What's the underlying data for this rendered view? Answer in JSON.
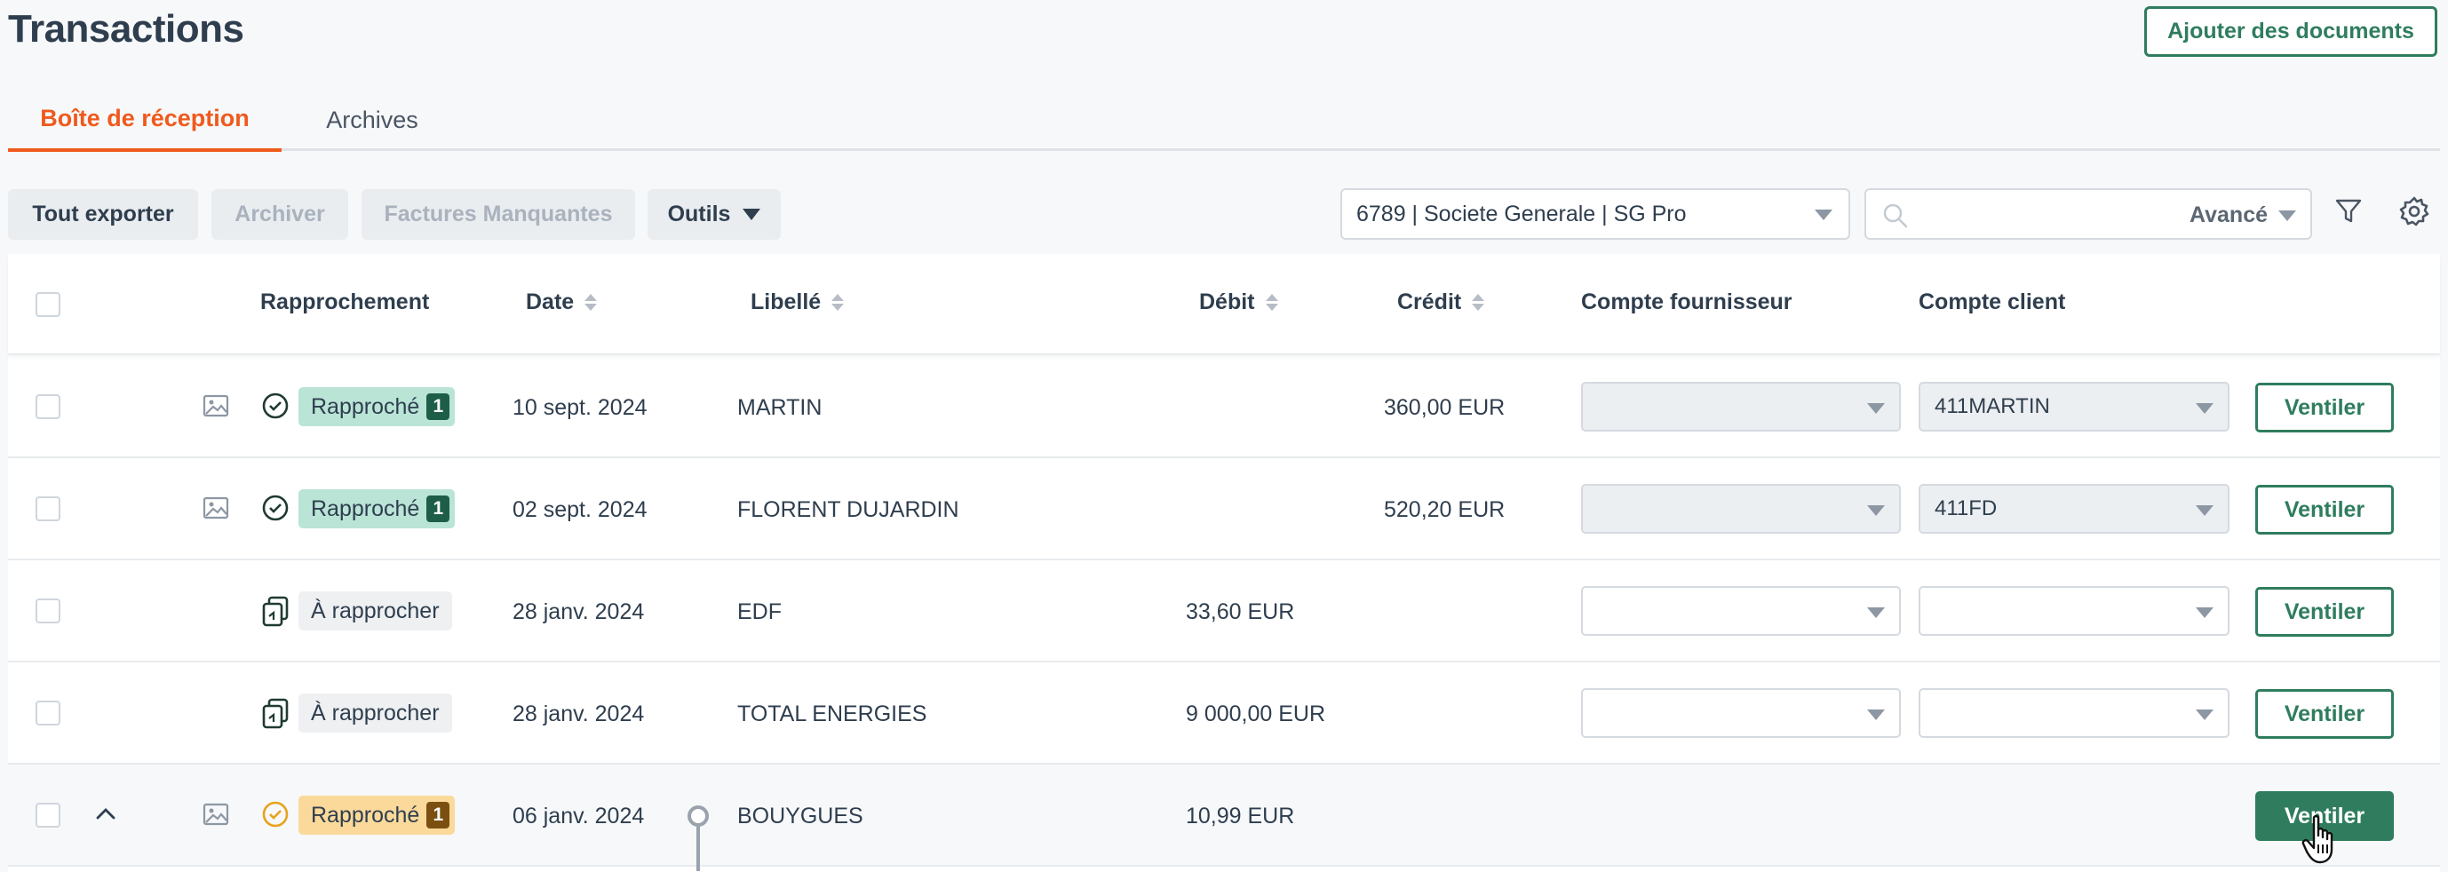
{
  "header": {
    "title": "Transactions",
    "add_docs_label": "Ajouter des documents"
  },
  "tabs": [
    {
      "label": "Boîte de réception",
      "active": true
    },
    {
      "label": "Archives",
      "active": false
    }
  ],
  "toolbar": {
    "export_label": "Tout exporter",
    "archive_label": "Archiver",
    "missing_label": "Factures Manquantes",
    "tools_label": "Outils",
    "account_value": "6789 | Societe Generale | SG Pro",
    "search_value": "",
    "advanced_label": "Avancé"
  },
  "table": {
    "columns": {
      "rapprochement": "Rapprochement",
      "date": "Date",
      "libelle": "Libellé",
      "debit": "Débit",
      "credit": "Crédit",
      "fournisseur": "Compte fournisseur",
      "client": "Compte client"
    },
    "rows": [
      {
        "status": "Rapproché",
        "count": "1",
        "date": "10 sept. 2024",
        "libelle": "MARTIN",
        "debit": "",
        "credit": "360,00 EUR",
        "fournisseur": "",
        "client": "411MARTIN",
        "action": "Ventiler"
      },
      {
        "status": "Rapproché",
        "count": "1",
        "date": "02 sept. 2024",
        "libelle": "FLORENT DUJARDIN",
        "debit": "",
        "credit": "520,20 EUR",
        "fournisseur": "",
        "client": "411FD",
        "action": "Ventiler"
      },
      {
        "status": "À rapprocher",
        "count": "",
        "date": "28 janv. 2024",
        "libelle": "EDF",
        "debit": "33,60 EUR",
        "credit": "",
        "fournisseur": "",
        "client": "",
        "action": "Ventiler"
      },
      {
        "status": "À rapprocher",
        "count": "",
        "date": "28 janv. 2024",
        "libelle": "TOTAL ENERGIES",
        "debit": "9 000,00 EUR",
        "credit": "",
        "fournisseur": "",
        "client": "",
        "action": "Ventiler"
      },
      {
        "status": "Rapproché",
        "count": "1",
        "date": "06 janv. 2024",
        "libelle": "BOUYGUES",
        "debit": "10,99 EUR",
        "credit": "",
        "fournisseur": "",
        "client": "",
        "action": "Ventiler"
      }
    ]
  },
  "colors": {
    "accent": "#ef5a1d",
    "primary": "#2f7d5e",
    "matched_bg": "#b9e4d6",
    "pending_bg": "#fbd99a"
  }
}
